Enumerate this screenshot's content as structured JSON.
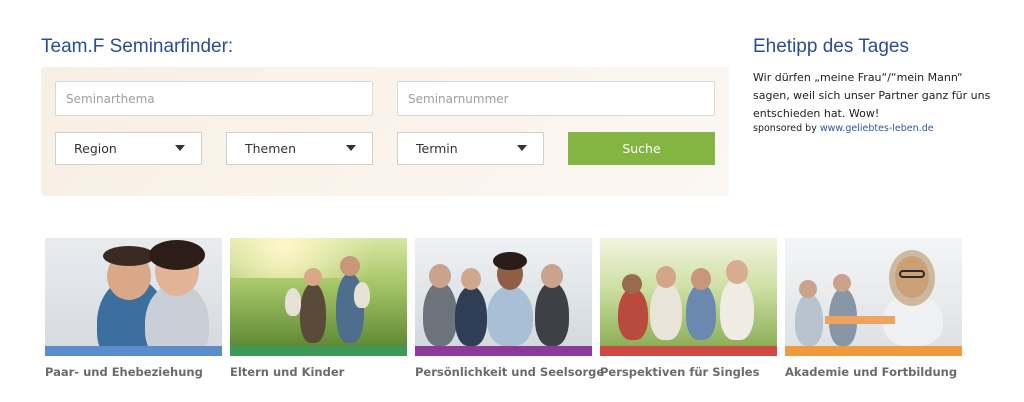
{
  "finder": {
    "title": "Team.F Seminarfinder:",
    "seminarthema_placeholder": "Seminarthema",
    "seminarnummer_placeholder": "Seminarnummer",
    "region_label": "Region",
    "themen_label": "Themen",
    "termin_label": "Termin",
    "search_label": "Suche"
  },
  "tip": {
    "title": "Ehetipp des Tages",
    "text": "Wir dürfen „meine Frau“/“mein Mann“ sagen, weil sich unser Partner ganz für uns entschieden hat. Wow!",
    "sponsor_prefix": "sponsored by",
    "sponsor_link": "www.geliebtes-leben.de"
  },
  "categories": [
    {
      "label": "Paar- und Ehebeziehung",
      "color": "#5b8ccc"
    },
    {
      "label": "Eltern und Kinder",
      "color": "#3f9a5a"
    },
    {
      "label": "Persönlichkeit und Seelsorge",
      "color": "#8c3a9a"
    },
    {
      "label": "Perspektiven für Singles",
      "color": "#cf4a45"
    },
    {
      "label": "Akademie und Fortbildung",
      "color": "#ef9a3c"
    }
  ]
}
